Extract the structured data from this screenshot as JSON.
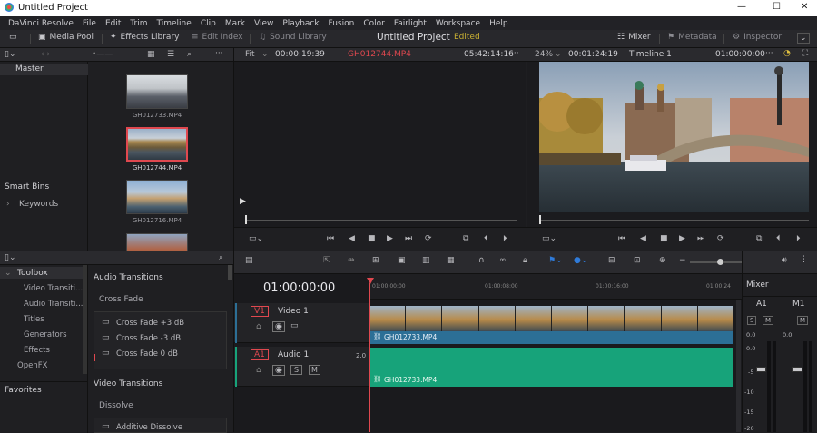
{
  "window": {
    "title": "Untitled Project",
    "minimize": "—",
    "maximize": "☐",
    "close": "✕"
  },
  "menu": [
    "DaVinci Resolve",
    "File",
    "Edit",
    "Trim",
    "Timeline",
    "Clip",
    "Mark",
    "View",
    "Playback",
    "Fusion",
    "Color",
    "Fairlight",
    "Workspace",
    "Help"
  ],
  "toolbar": {
    "media_pool": "Media Pool",
    "effects_library": "Effects Library",
    "edit_index": "Edit Index",
    "sound_library": "Sound Library",
    "project_name": "Untitled Project",
    "edited": "Edited",
    "mixer": "Mixer",
    "metadata": "Metadata",
    "inspector": "Inspector"
  },
  "mediapool": {
    "bin_master": "Master",
    "smart_bins": "Smart Bins",
    "keywords": "Keywords",
    "clips": [
      "GH012733.MP4",
      "GH012744.MP4",
      "GH012716.MP4"
    ]
  },
  "source_viewer": {
    "fit": "Fit",
    "timecode": "00:00:19:39",
    "clip": "GH012744.MP4",
    "duration": "05:42:14:16"
  },
  "timeline_viewer": {
    "zoom": "24%",
    "timecode": "00:01:24:19",
    "timeline": "Timeline 1",
    "position": "01:00:00:00"
  },
  "effects": {
    "toolbox": "Toolbox",
    "items": [
      "Video Transiti...",
      "Audio Transiti...",
      "Titles",
      "Generators",
      "Effects"
    ],
    "openfx": "OpenFX",
    "favorites": "Favorites",
    "audio_transitions": "Audio Transitions",
    "cross_fade": "Cross Fade",
    "cross_fade_items": [
      "Cross Fade +3 dB",
      "Cross Fade -3 dB",
      "Cross Fade 0 dB"
    ],
    "video_transitions": "Video Transitions",
    "dissolve": "Dissolve",
    "additive_dissolve": "Additive Dissolve"
  },
  "timeline": {
    "timecode": "01:00:00:00",
    "ruler": [
      "01:00:00:00",
      "01:00:08:00",
      "01:00:16:00",
      "01:00:24"
    ],
    "video_track": {
      "id": "V1",
      "name": "Video 1",
      "clip": "GH012733.MP4"
    },
    "audio_track": {
      "id": "A1",
      "name": "Audio 1",
      "level": "2.0",
      "clip": "GH012733.MP4",
      "s": "S",
      "m": "M"
    }
  },
  "mixer": {
    "title": "Mixer",
    "a1": "A1",
    "m1": "M1",
    "s": "S",
    "m": "M",
    "scale": [
      "0.0",
      "-5",
      "-10",
      "-15",
      "-20"
    ],
    "val": "0.0"
  },
  "colors": {
    "accent_red": "#e0484f",
    "video_clip": "#2c6f96",
    "audio_clip": "#17a37a",
    "edited": "#c9b033"
  }
}
